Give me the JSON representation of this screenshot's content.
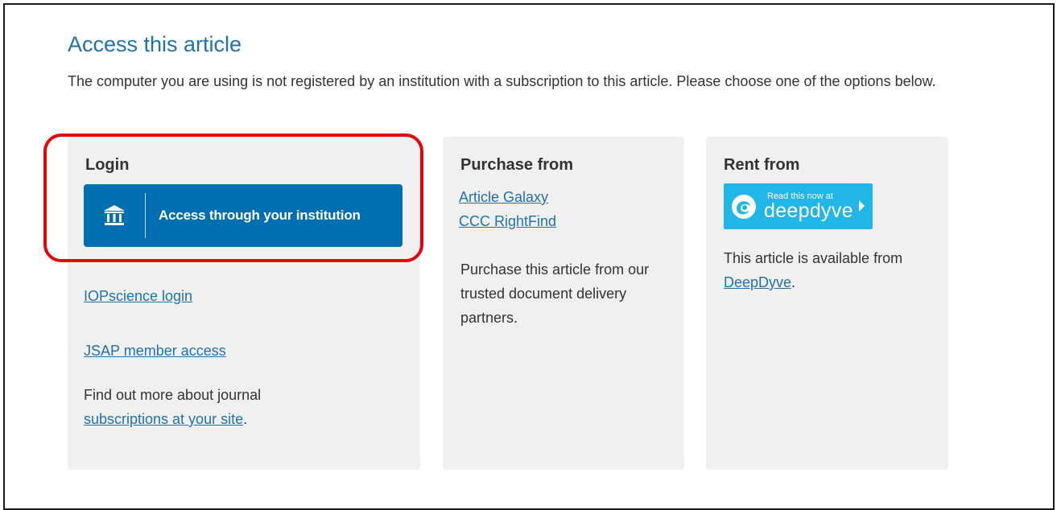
{
  "page": {
    "title": "Access this article",
    "intro": "The computer you are using is not registered by an institution with a subscription to this article. Please choose one of the options below."
  },
  "login": {
    "heading": "Login",
    "institution_button": "Access through your institution",
    "iop_login": "IOPscience login",
    "jsap_access": "JSAP member access",
    "find_out_prefix": "Find out more about journal",
    "subscriptions_link": "subscriptions at your site",
    "find_out_suffix": "."
  },
  "purchase": {
    "heading": "Purchase from",
    "vendors": [
      "Article Galaxy",
      "CCC RightFind"
    ],
    "description": "Purchase this article from our trusted document delivery partners."
  },
  "rent": {
    "heading": "Rent from",
    "badge_small": "Read this now at",
    "badge_brand": "deepdyve",
    "description_prefix": "This article is available from",
    "deepdyve_link": "DeepDyve",
    "description_suffix": "."
  },
  "colors": {
    "accent": "#2271a8",
    "button": "#006fb2",
    "highlight": "#e8000c",
    "deepdyve": "#21b6e8",
    "card": "#f0f0f0"
  },
  "icons": [
    "institution-icon",
    "deepdyve-logo-icon",
    "chevron-right-icon"
  ]
}
